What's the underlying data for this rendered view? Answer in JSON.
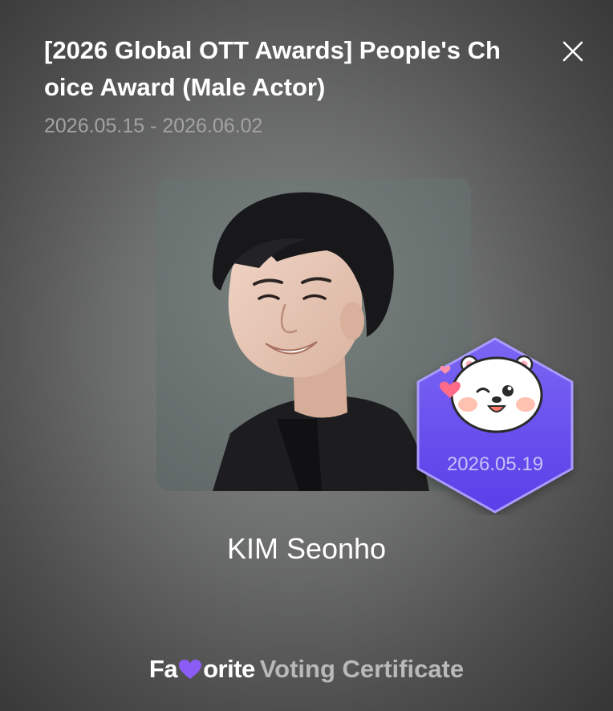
{
  "event": {
    "title": "[2026 Global OTT Awards] People's Choice Award (Male Actor)",
    "dates": "2026.05.15 - 2026.06.02"
  },
  "close": {
    "icon": "close-icon"
  },
  "candidate": {
    "name": "KIM Seonho",
    "photo": "candidate-portrait"
  },
  "badge": {
    "date": "2026.05.19",
    "icon": "bear-mascot-icon",
    "color": "#6448ec"
  },
  "footer": {
    "brand_start": "Fa",
    "brand_icon": "heart-icon",
    "brand_end": "orite",
    "label": "Voting Certificate"
  },
  "colors": {
    "accent_purple": "#6448ec",
    "heart_purple": "#8b5cf6"
  }
}
